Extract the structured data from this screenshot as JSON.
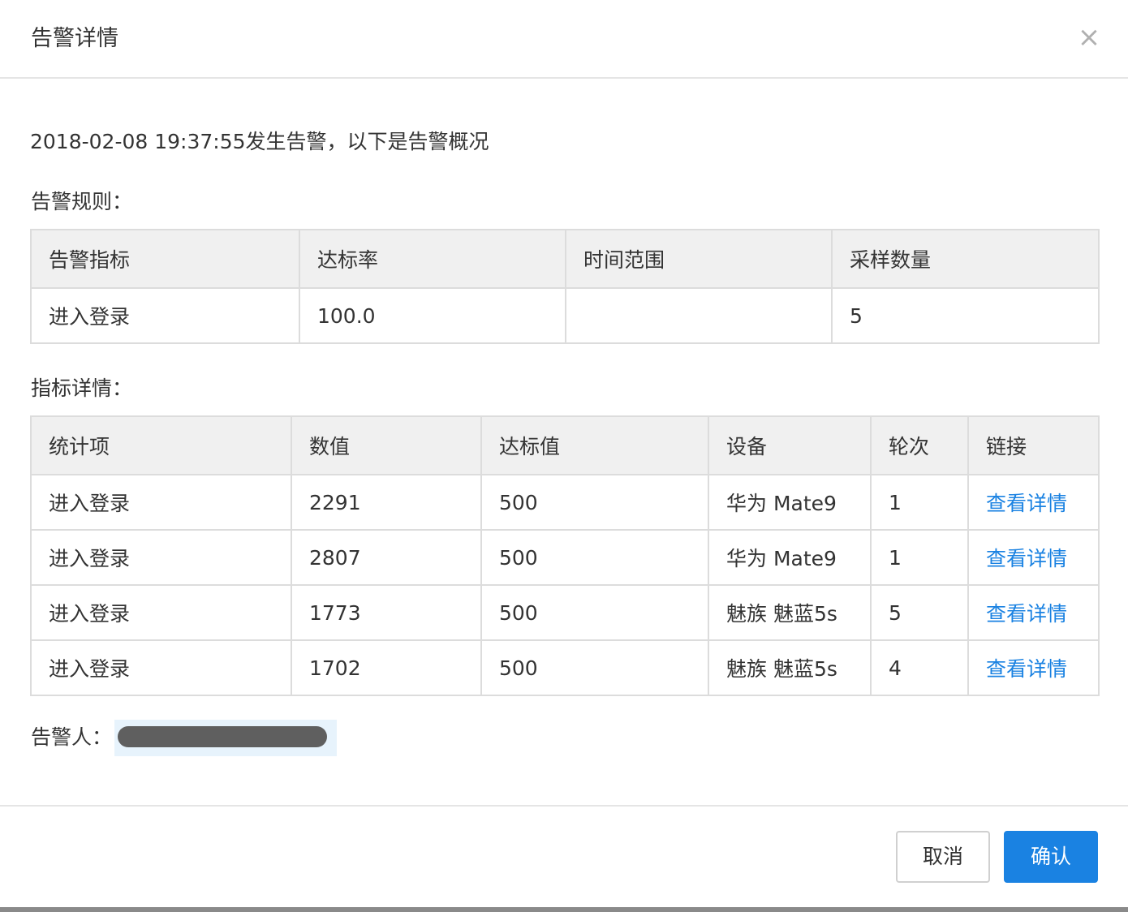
{
  "dialog": {
    "title": "告警详情",
    "close_glyph": "×"
  },
  "summary": {
    "text": "2018-02-08 19:37:55发生告警，以下是告警概况"
  },
  "rules": {
    "label": "告警规则：",
    "headers": [
      "告警指标",
      "达标率",
      "时间范围",
      "采样数量"
    ],
    "row": [
      "进入登录",
      "100.0",
      "",
      "5"
    ]
  },
  "metrics": {
    "label": "指标详情：",
    "headers": [
      "统计项",
      "数值",
      "达标值",
      "设备",
      "轮次",
      "链接"
    ],
    "rows": [
      [
        "进入登录",
        "2291",
        "500",
        "华为 Mate9",
        "1",
        "查看详情"
      ],
      [
        "进入登录",
        "2807",
        "500",
        "华为 Mate9",
        "1",
        "查看详情"
      ],
      [
        "进入登录",
        "1773",
        "500",
        "魅族 魅蓝5s",
        "5",
        "查看详情"
      ],
      [
        "进入登录",
        "1702",
        "500",
        "魅族 魅蓝5s",
        "4",
        "查看详情"
      ]
    ]
  },
  "alerter": {
    "label": "告警人："
  },
  "footer": {
    "cancel_label": "取消",
    "confirm_label": "确认"
  },
  "colors": {
    "primary": "#1a82e2",
    "link": "#1a82e2",
    "header_bg": "#f0f0f0",
    "border": "#dcdcdc"
  }
}
